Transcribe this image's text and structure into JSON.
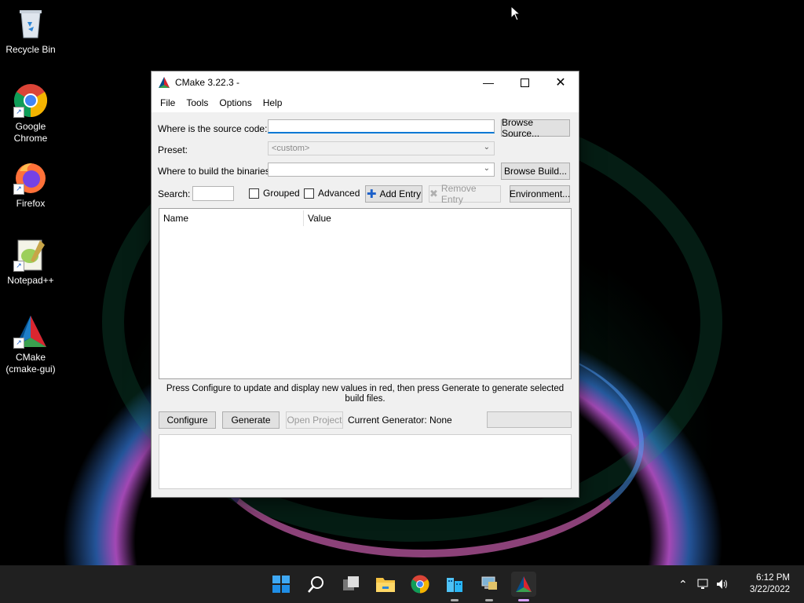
{
  "desktop": {
    "icons": [
      {
        "label": "Recycle Bin"
      },
      {
        "label": "Google Chrome"
      },
      {
        "label": "Firefox"
      },
      {
        "label": "Notepad++"
      },
      {
        "label": "CMake (cmake-gui)"
      }
    ]
  },
  "window": {
    "title": "CMake 3.22.3 -",
    "menu": [
      "File",
      "Tools",
      "Options",
      "Help"
    ],
    "source_label": "Where is the source code:",
    "source_value": "",
    "browse_source": "Browse Source...",
    "preset_label": "Preset:",
    "preset_value": "<custom>",
    "build_label": "Where to build the binaries:",
    "build_value": "",
    "browse_build": "Browse Build...",
    "search_label": "Search:",
    "search_value": "",
    "grouped_label": "Grouped",
    "advanced_label": "Advanced",
    "add_entry": "Add Entry",
    "remove_entry": "Remove Entry",
    "environment": "Environment...",
    "table_headers": [
      "Name",
      "Value"
    ],
    "hint": "Press Configure to update and display new values in red, then press Generate to generate selected build files.",
    "configure": "Configure",
    "generate": "Generate",
    "open_project": "Open Project",
    "current_generator": "Current Generator: None"
  },
  "taskbar": {
    "time": "6:12 PM",
    "date": "3/22/2022",
    "apps": [
      "start-icon",
      "search-icon",
      "task-view-icon",
      "file-explorer-icon",
      "chrome-icon",
      "buildings-icon",
      "network-app-icon",
      "cmake-icon"
    ]
  },
  "colors": {
    "accent": "#0078d4",
    "taskbar": "#202020",
    "window_bg": "#f0f0f0"
  }
}
